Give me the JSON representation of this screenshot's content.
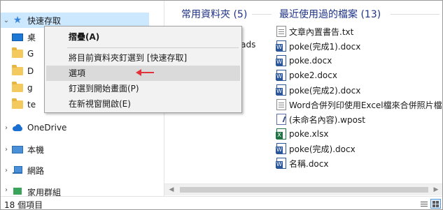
{
  "nav": {
    "quick_access": {
      "label": "快速存取",
      "chevron": "chevron-down-icon",
      "icon": "star-icon"
    },
    "pinned_items": [
      {
        "label": "桌",
        "icon": "desktop-icon"
      },
      {
        "label": "G",
        "icon": "folder-icon"
      },
      {
        "label": "D",
        "icon": "folder-icon"
      },
      {
        "label": "g",
        "icon": "folder-icon"
      },
      {
        "label": "te",
        "icon": "folder-icon"
      }
    ],
    "onedrive": {
      "label": "OneDrive",
      "chevron": "chevron-right-icon",
      "icon": "cloud-icon"
    },
    "this_pc": {
      "label": "本機",
      "chevron": "chevron-right-icon",
      "icon": "computer-icon"
    },
    "network": {
      "label": "網路",
      "chevron": "chevron-right-icon",
      "icon": "network-icon"
    },
    "homegroup": {
      "label": "家用群組",
      "chevron": "chevron-right-icon",
      "icon": "homegroup-icon"
    }
  },
  "content": {
    "frequent_title": "常用資料夾 (5)",
    "recent_title": "最近使用過的檔案 (13)",
    "frequent_partial": "wnloads",
    "recent_files": [
      {
        "name": "文章內置書告.txt",
        "type": "txt"
      },
      {
        "name": "poke(完成1).docx",
        "type": "word"
      },
      {
        "name": "poke.docx",
        "type": "word"
      },
      {
        "name": "poke2.docx",
        "type": "word"
      },
      {
        "name": "poke(完成2).docx",
        "type": "word"
      },
      {
        "name": "Word合併列印使用Excel檔來合併照片檔",
        "type": "txt"
      },
      {
        "name": "(未命名內容).wpost",
        "type": "wpost"
      },
      {
        "name": "poke.xlsx",
        "type": "excel"
      },
      {
        "name": "poke(完成).docx",
        "type": "word"
      },
      {
        "name": "名稱.docx",
        "type": "word"
      }
    ]
  },
  "context_menu": {
    "items": [
      {
        "label": "摺疊(A)",
        "bold": true
      },
      {
        "label": "將目前資料夾釘選到 [快速存取]"
      },
      {
        "label": "選項",
        "highlighted": true
      },
      {
        "label": "釘選到開始畫面(P)"
      },
      {
        "label": "在新視窗開啟(E)"
      }
    ],
    "annotation_arrow_color": "#e0343a"
  },
  "status": {
    "item_count": "18 個項目"
  },
  "colors": {
    "selection": "#cce8ff",
    "section_title": "#1e3287",
    "menu_bg": "#f2f2f2",
    "menu_hover": "#dadada"
  }
}
